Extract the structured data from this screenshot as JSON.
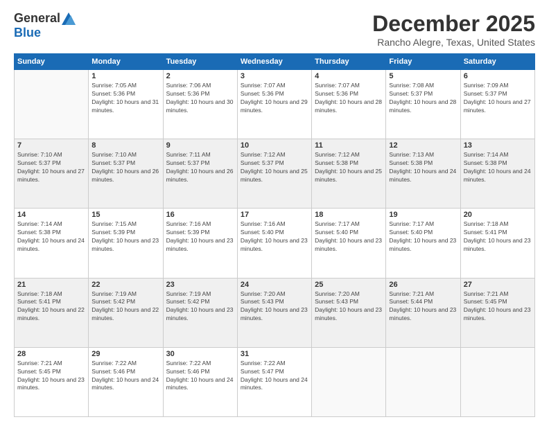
{
  "header": {
    "logo_general": "General",
    "logo_blue": "Blue",
    "month_title": "December 2025",
    "location": "Rancho Alegre, Texas, United States"
  },
  "weekdays": [
    "Sunday",
    "Monday",
    "Tuesday",
    "Wednesday",
    "Thursday",
    "Friday",
    "Saturday"
  ],
  "weeks": [
    [
      {
        "day": "",
        "sunrise": "",
        "sunset": "",
        "daylight": "",
        "empty": true
      },
      {
        "day": "1",
        "sunrise": "Sunrise: 7:05 AM",
        "sunset": "Sunset: 5:36 PM",
        "daylight": "Daylight: 10 hours and 31 minutes."
      },
      {
        "day": "2",
        "sunrise": "Sunrise: 7:06 AM",
        "sunset": "Sunset: 5:36 PM",
        "daylight": "Daylight: 10 hours and 30 minutes."
      },
      {
        "day": "3",
        "sunrise": "Sunrise: 7:07 AM",
        "sunset": "Sunset: 5:36 PM",
        "daylight": "Daylight: 10 hours and 29 minutes."
      },
      {
        "day": "4",
        "sunrise": "Sunrise: 7:07 AM",
        "sunset": "Sunset: 5:36 PM",
        "daylight": "Daylight: 10 hours and 28 minutes."
      },
      {
        "day": "5",
        "sunrise": "Sunrise: 7:08 AM",
        "sunset": "Sunset: 5:37 PM",
        "daylight": "Daylight: 10 hours and 28 minutes."
      },
      {
        "day": "6",
        "sunrise": "Sunrise: 7:09 AM",
        "sunset": "Sunset: 5:37 PM",
        "daylight": "Daylight: 10 hours and 27 minutes."
      }
    ],
    [
      {
        "day": "7",
        "sunrise": "Sunrise: 7:10 AM",
        "sunset": "Sunset: 5:37 PM",
        "daylight": "Daylight: 10 hours and 27 minutes."
      },
      {
        "day": "8",
        "sunrise": "Sunrise: 7:10 AM",
        "sunset": "Sunset: 5:37 PM",
        "daylight": "Daylight: 10 hours and 26 minutes."
      },
      {
        "day": "9",
        "sunrise": "Sunrise: 7:11 AM",
        "sunset": "Sunset: 5:37 PM",
        "daylight": "Daylight: 10 hours and 26 minutes."
      },
      {
        "day": "10",
        "sunrise": "Sunrise: 7:12 AM",
        "sunset": "Sunset: 5:37 PM",
        "daylight": "Daylight: 10 hours and 25 minutes."
      },
      {
        "day": "11",
        "sunrise": "Sunrise: 7:12 AM",
        "sunset": "Sunset: 5:38 PM",
        "daylight": "Daylight: 10 hours and 25 minutes."
      },
      {
        "day": "12",
        "sunrise": "Sunrise: 7:13 AM",
        "sunset": "Sunset: 5:38 PM",
        "daylight": "Daylight: 10 hours and 24 minutes."
      },
      {
        "day": "13",
        "sunrise": "Sunrise: 7:14 AM",
        "sunset": "Sunset: 5:38 PM",
        "daylight": "Daylight: 10 hours and 24 minutes."
      }
    ],
    [
      {
        "day": "14",
        "sunrise": "Sunrise: 7:14 AM",
        "sunset": "Sunset: 5:38 PM",
        "daylight": "Daylight: 10 hours and 24 minutes."
      },
      {
        "day": "15",
        "sunrise": "Sunrise: 7:15 AM",
        "sunset": "Sunset: 5:39 PM",
        "daylight": "Daylight: 10 hours and 23 minutes."
      },
      {
        "day": "16",
        "sunrise": "Sunrise: 7:16 AM",
        "sunset": "Sunset: 5:39 PM",
        "daylight": "Daylight: 10 hours and 23 minutes."
      },
      {
        "day": "17",
        "sunrise": "Sunrise: 7:16 AM",
        "sunset": "Sunset: 5:40 PM",
        "daylight": "Daylight: 10 hours and 23 minutes."
      },
      {
        "day": "18",
        "sunrise": "Sunrise: 7:17 AM",
        "sunset": "Sunset: 5:40 PM",
        "daylight": "Daylight: 10 hours and 23 minutes."
      },
      {
        "day": "19",
        "sunrise": "Sunrise: 7:17 AM",
        "sunset": "Sunset: 5:40 PM",
        "daylight": "Daylight: 10 hours and 23 minutes."
      },
      {
        "day": "20",
        "sunrise": "Sunrise: 7:18 AM",
        "sunset": "Sunset: 5:41 PM",
        "daylight": "Daylight: 10 hours and 23 minutes."
      }
    ],
    [
      {
        "day": "21",
        "sunrise": "Sunrise: 7:18 AM",
        "sunset": "Sunset: 5:41 PM",
        "daylight": "Daylight: 10 hours and 22 minutes."
      },
      {
        "day": "22",
        "sunrise": "Sunrise: 7:19 AM",
        "sunset": "Sunset: 5:42 PM",
        "daylight": "Daylight: 10 hours and 22 minutes."
      },
      {
        "day": "23",
        "sunrise": "Sunrise: 7:19 AM",
        "sunset": "Sunset: 5:42 PM",
        "daylight": "Daylight: 10 hours and 23 minutes."
      },
      {
        "day": "24",
        "sunrise": "Sunrise: 7:20 AM",
        "sunset": "Sunset: 5:43 PM",
        "daylight": "Daylight: 10 hours and 23 minutes."
      },
      {
        "day": "25",
        "sunrise": "Sunrise: 7:20 AM",
        "sunset": "Sunset: 5:43 PM",
        "daylight": "Daylight: 10 hours and 23 minutes."
      },
      {
        "day": "26",
        "sunrise": "Sunrise: 7:21 AM",
        "sunset": "Sunset: 5:44 PM",
        "daylight": "Daylight: 10 hours and 23 minutes."
      },
      {
        "day": "27",
        "sunrise": "Sunrise: 7:21 AM",
        "sunset": "Sunset: 5:45 PM",
        "daylight": "Daylight: 10 hours and 23 minutes."
      }
    ],
    [
      {
        "day": "28",
        "sunrise": "Sunrise: 7:21 AM",
        "sunset": "Sunset: 5:45 PM",
        "daylight": "Daylight: 10 hours and 23 minutes."
      },
      {
        "day": "29",
        "sunrise": "Sunrise: 7:22 AM",
        "sunset": "Sunset: 5:46 PM",
        "daylight": "Daylight: 10 hours and 24 minutes."
      },
      {
        "day": "30",
        "sunrise": "Sunrise: 7:22 AM",
        "sunset": "Sunset: 5:46 PM",
        "daylight": "Daylight: 10 hours and 24 minutes."
      },
      {
        "day": "31",
        "sunrise": "Sunrise: 7:22 AM",
        "sunset": "Sunset: 5:47 PM",
        "daylight": "Daylight: 10 hours and 24 minutes."
      },
      {
        "day": "",
        "sunrise": "",
        "sunset": "",
        "daylight": "",
        "empty": true
      },
      {
        "day": "",
        "sunrise": "",
        "sunset": "",
        "daylight": "",
        "empty": true
      },
      {
        "day": "",
        "sunrise": "",
        "sunset": "",
        "daylight": "",
        "empty": true
      }
    ]
  ]
}
